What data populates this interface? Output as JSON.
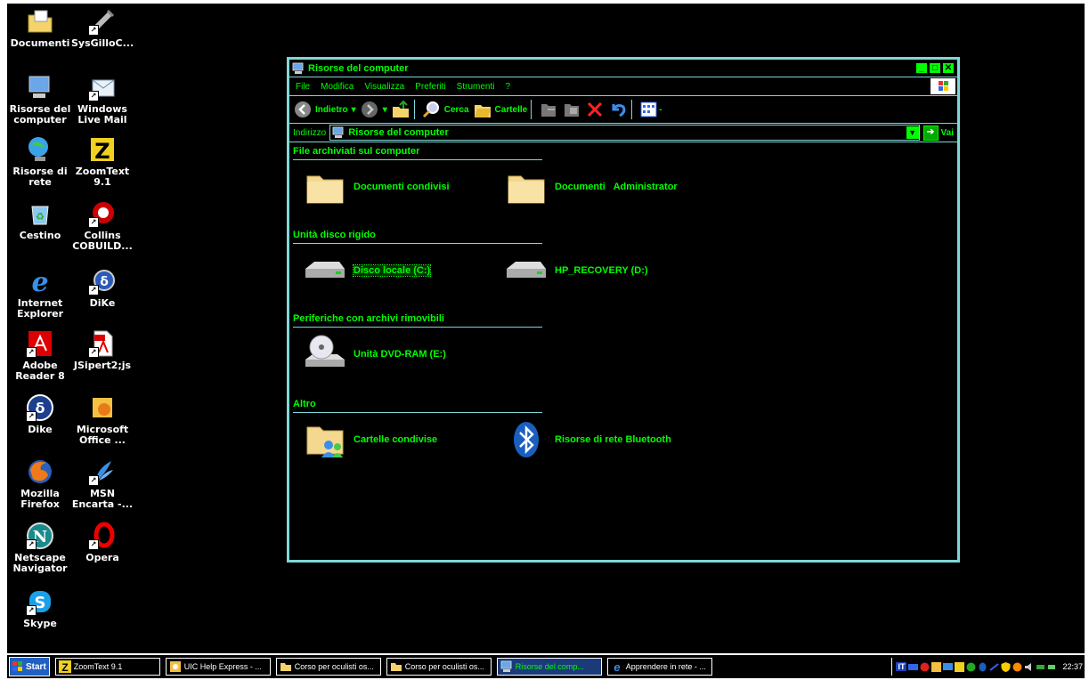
{
  "desktop_icons": [
    {
      "label": "Documenti",
      "icon": "folder-documents-icon"
    },
    {
      "label": "SysGilloC...",
      "icon": "syringe-icon"
    },
    {
      "label": "Risorse del computer",
      "icon": "computer-icon"
    },
    {
      "label": "Windows Live Mail",
      "icon": "mail-icon"
    },
    {
      "label": "Risorse di rete",
      "icon": "network-globe-icon"
    },
    {
      "label": "ZoomText 9.1",
      "icon": "zoomtext-icon"
    },
    {
      "label": "Cestino",
      "icon": "recycle-bin-icon"
    },
    {
      "label": "Collins COBUILD...",
      "icon": "collins-icon"
    },
    {
      "label": "Internet Explorer",
      "icon": "ie-icon"
    },
    {
      "label": "DiKe",
      "icon": "dike-icon"
    },
    {
      "label": "Adobe Reader 8",
      "icon": "adobe-reader-icon"
    },
    {
      "label": "JSipert2;js",
      "icon": "pdf-file-icon"
    },
    {
      "label": "Dike",
      "icon": "dike-icon"
    },
    {
      "label": "Microsoft Office ...",
      "icon": "office-icon"
    },
    {
      "label": "Mozilla Firefox",
      "icon": "firefox-icon"
    },
    {
      "label": "MSN Encarta -...",
      "icon": "encarta-icon"
    },
    {
      "label": "Netscape Navigator",
      "icon": "netscape-icon"
    },
    {
      "label": "Opera",
      "icon": "opera-icon"
    },
    {
      "label": "Skype",
      "icon": "skype-icon"
    }
  ],
  "window": {
    "title": "Risorse del computer",
    "menu": [
      "File",
      "Modifica",
      "Visualizza",
      "Preferiti",
      "Strumenti",
      "?"
    ],
    "toolbar": {
      "back": "Indietro",
      "search": "Cerca",
      "folders": "Cartelle"
    },
    "address": {
      "label": "Indirizzo",
      "value": "Risorse del computer",
      "go": "Vai"
    },
    "groups": [
      {
        "title": "File archiviati sul computer",
        "items": [
          "Documenti condivisi",
          "Documenti   Administrator"
        ]
      },
      {
        "title": "Unità disco rigido",
        "items": [
          "Disco locale (C:)",
          "HP_RECOVERY (D:)"
        ]
      },
      {
        "title": "Periferiche con archivi rimovibili",
        "items": [
          "Unità DVD-RAM (E:)"
        ]
      },
      {
        "title": "Altro",
        "items": [
          "Cartelle condivise",
          "Risorse di rete Bluetooth"
        ]
      }
    ]
  },
  "taskbar": {
    "start": "Start",
    "tasks": [
      "ZoomText 9.1",
      "UIC Help Express - ...",
      "Corso per oculisti os...",
      "Corso per oculisti os...",
      "Risorse del comp...",
      "Apprendere in rete - ..."
    ],
    "lang": "IT",
    "clock": "22:37"
  },
  "colors": {
    "accent": "#00ff00",
    "border": "#7fd7d7",
    "background": "#000000"
  }
}
